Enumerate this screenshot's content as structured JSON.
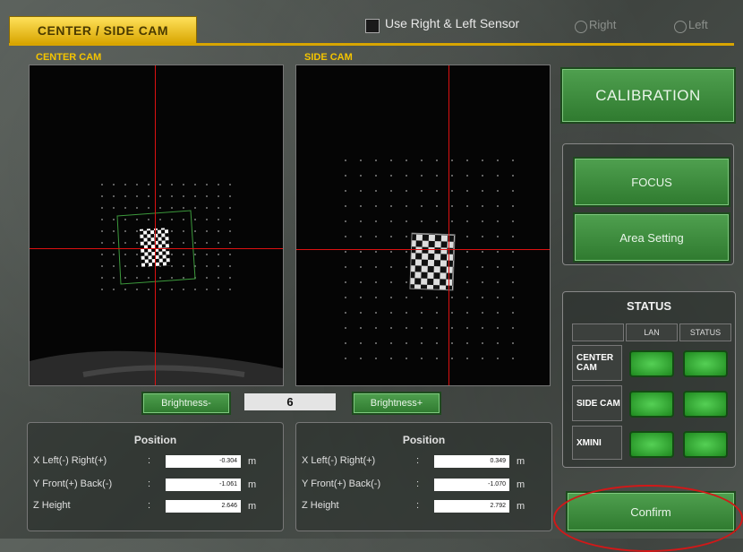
{
  "header": {
    "tab_title": "CENTER / SIDE CAM",
    "sensor_checkbox_label": "Use Right & Left Sensor",
    "radio_right_label": "Right",
    "radio_left_label": "Left"
  },
  "cameras": {
    "center_label": "CENTER CAM",
    "side_label": "SIDE CAM"
  },
  "brightness": {
    "minus_label": "Brightness-",
    "value": "6",
    "plus_label": "Brightness+"
  },
  "position_center": {
    "title": "Position",
    "rows": [
      {
        "label": "X  Left(-) Right(+)",
        "value": "-0.304",
        "unit": "m"
      },
      {
        "label": "Y  Front(+) Back(-)",
        "value": "-1.061",
        "unit": "m"
      },
      {
        "label": "Z  Height",
        "value": "2.646",
        "unit": "m"
      }
    ]
  },
  "position_side": {
    "title": "Position",
    "rows": [
      {
        "label": "X  Left(-) Right(+)",
        "value": "0.349",
        "unit": "m"
      },
      {
        "label": "Y  Front(+) Back(-)",
        "value": "-1.070",
        "unit": "m"
      },
      {
        "label": "Z  Height",
        "value": "2.792",
        "unit": "m"
      }
    ]
  },
  "right_panel": {
    "calibration_label": "CALIBRATION",
    "focus_label": "FOCUS",
    "area_setting_label": "Area Setting",
    "confirm_label": "Confirm"
  },
  "status": {
    "title": "STATUS",
    "col_lan": "LAN",
    "col_status": "STATUS",
    "rows": [
      "CENTER CAM",
      "SIDE CAM",
      "XMINI"
    ]
  },
  "colors": {
    "accent_yellow": "#f4c400",
    "button_green": "#3f8f3f",
    "crosshair_red": "#dd1111",
    "highlight_red": "#d21818"
  }
}
